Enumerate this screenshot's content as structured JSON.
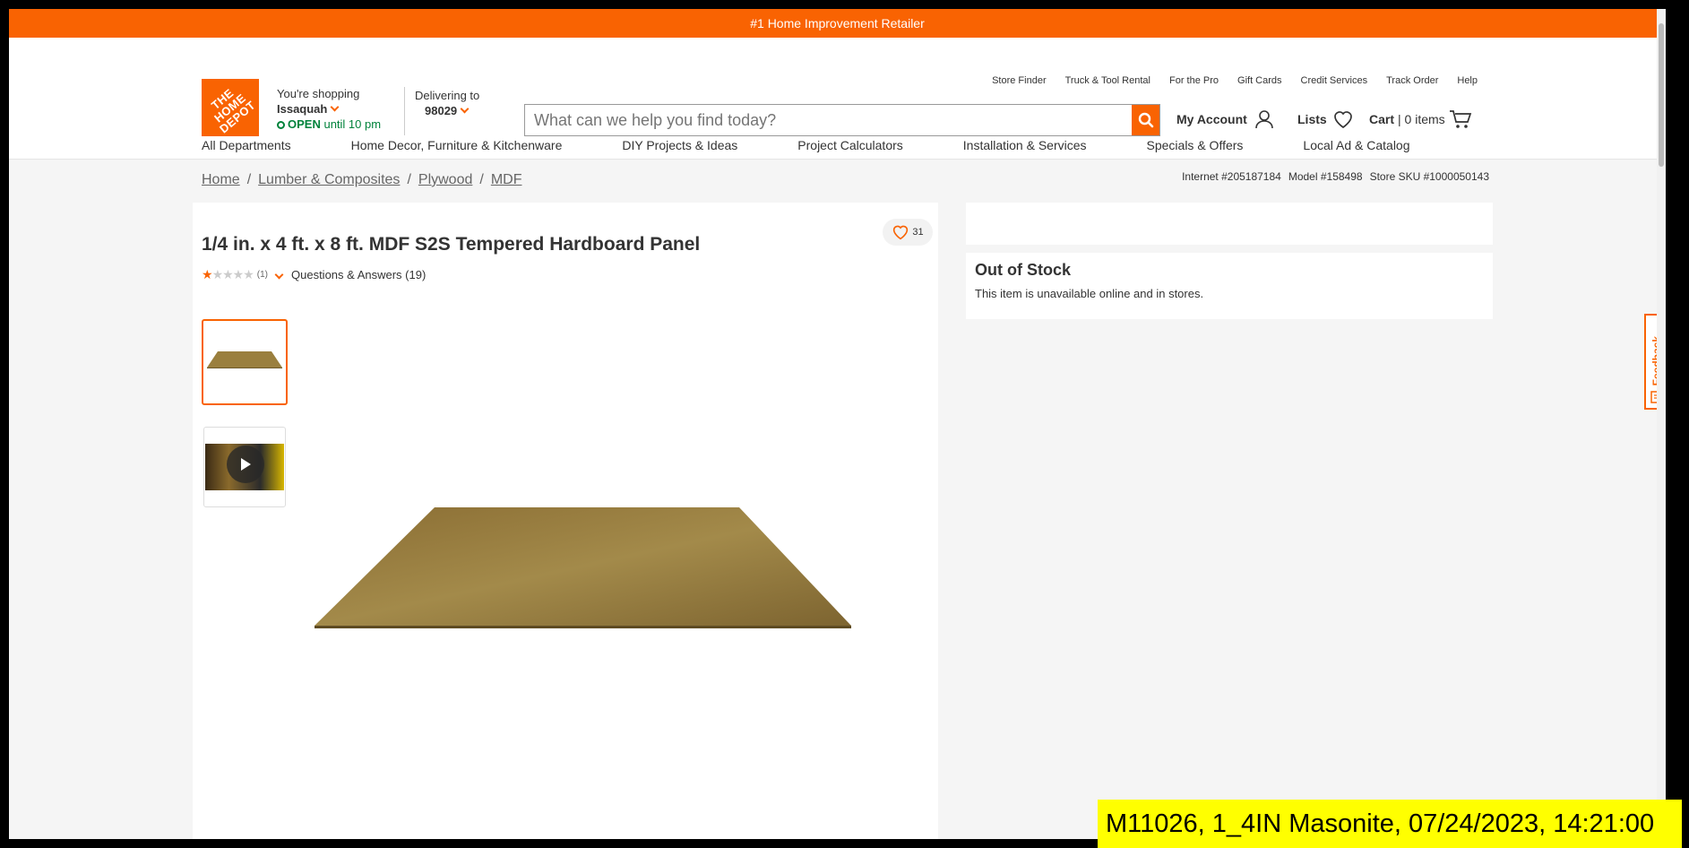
{
  "promo_banner": "#1 Home Improvement Retailer",
  "logo": {
    "text": "THE HOME DEPOT",
    "color": "#f96302"
  },
  "store": {
    "label": "You're shopping",
    "name": "Issaquah",
    "status": "OPEN",
    "hours": "until 10 pm"
  },
  "delivery": {
    "label": "Delivering to",
    "zip": "98029"
  },
  "utility_links": [
    "Store Finder",
    "Truck & Tool Rental",
    "For the Pro",
    "Gift Cards",
    "Credit Services",
    "Track Order",
    "Help"
  ],
  "search": {
    "placeholder": "What can we help you find today?"
  },
  "account": {
    "label": "My Account"
  },
  "lists": {
    "label": "Lists"
  },
  "cart": {
    "label": "Cart",
    "count": "| 0 items"
  },
  "nav": [
    "All Departments",
    "Home Decor, Furniture & Kitchenware",
    "DIY Projects & Ideas",
    "Project Calculators",
    "Installation & Services",
    "Specials & Offers",
    "Local Ad & Catalog"
  ],
  "breadcrumbs": [
    "Home",
    "Lumber & Composites",
    "Plywood",
    "MDF"
  ],
  "product_ids": {
    "internet": "Internet #205187184",
    "model": "Model #158498",
    "sku": "Store SKU #1000050143"
  },
  "product": {
    "title": "1/4 in. x 4 ft. x 8 ft. MDF S2S Tempered Hardboard Panel",
    "favorites_count": "31",
    "rating": 1,
    "rating_max": 5,
    "review_count": "(1)",
    "qa_label": "Questions & Answers (19)"
  },
  "availability": {
    "title": "Out of Stock",
    "message": "This item is unavailable online and in stores."
  },
  "feedback_label": "Feedback",
  "overlay_caption": "M11026, 1_4IN Masonite, 07/24/2023, 14:21:00",
  "colors": {
    "accent": "#f96302",
    "open_green": "#00823b",
    "overlay_bg": "#ffff00"
  }
}
